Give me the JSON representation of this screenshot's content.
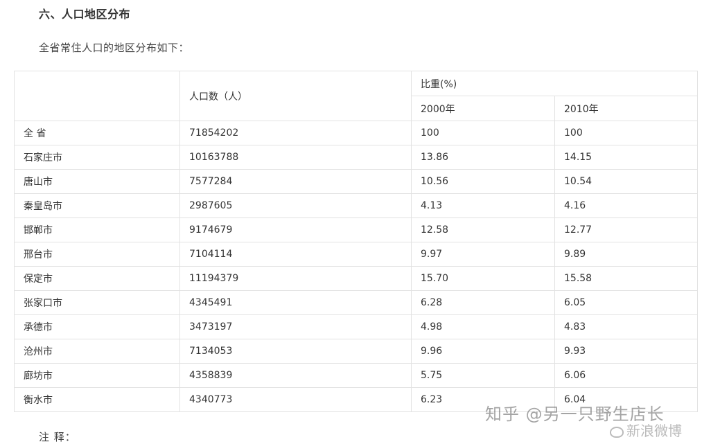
{
  "heading": "六、人口地区分布",
  "intro": "全省常住人口的地区分布如下：",
  "table": {
    "header_population": "人口数（人）",
    "header_share": "比重(%)",
    "header_year_2000": "2000年",
    "header_year_2010": "2010年",
    "rows": [
      {
        "region": "全 省",
        "population": "71854202",
        "share_2000": "100",
        "share_2010": "100"
      },
      {
        "region": "石家庄市",
        "population": "10163788",
        "share_2000": "13.86",
        "share_2010": "14.15"
      },
      {
        "region": "唐山市",
        "population": "7577284",
        "share_2000": "10.56",
        "share_2010": "10.54"
      },
      {
        "region": "秦皇岛市",
        "population": "2987605",
        "share_2000": "4.13",
        "share_2010": "4.16"
      },
      {
        "region": "邯郸市",
        "population": "9174679",
        "share_2000": "12.58",
        "share_2010": "12.77"
      },
      {
        "region": "邢台市",
        "population": "7104114",
        "share_2000": "9.97",
        "share_2010": "9.89"
      },
      {
        "region": "保定市",
        "population": "11194379",
        "share_2000": "15.70",
        "share_2010": "15.58"
      },
      {
        "region": "张家口市",
        "population": "4345491",
        "share_2000": "6.28",
        "share_2010": "6.05"
      },
      {
        "region": "承德市",
        "population": "3473197",
        "share_2000": "4.98",
        "share_2010": "4.83"
      },
      {
        "region": "沧州市",
        "population": "7134053",
        "share_2000": "9.96",
        "share_2010": "9.93"
      },
      {
        "region": "廊坊市",
        "population": "4358839",
        "share_2000": "5.75",
        "share_2010": "6.06"
      },
      {
        "region": "衡水市",
        "population": "4340773",
        "share_2000": "6.23",
        "share_2010": "6.04"
      }
    ]
  },
  "note": "注 释：",
  "watermark": "知乎 @另一只野生店长",
  "watermark_weibo": "新浪微博"
}
